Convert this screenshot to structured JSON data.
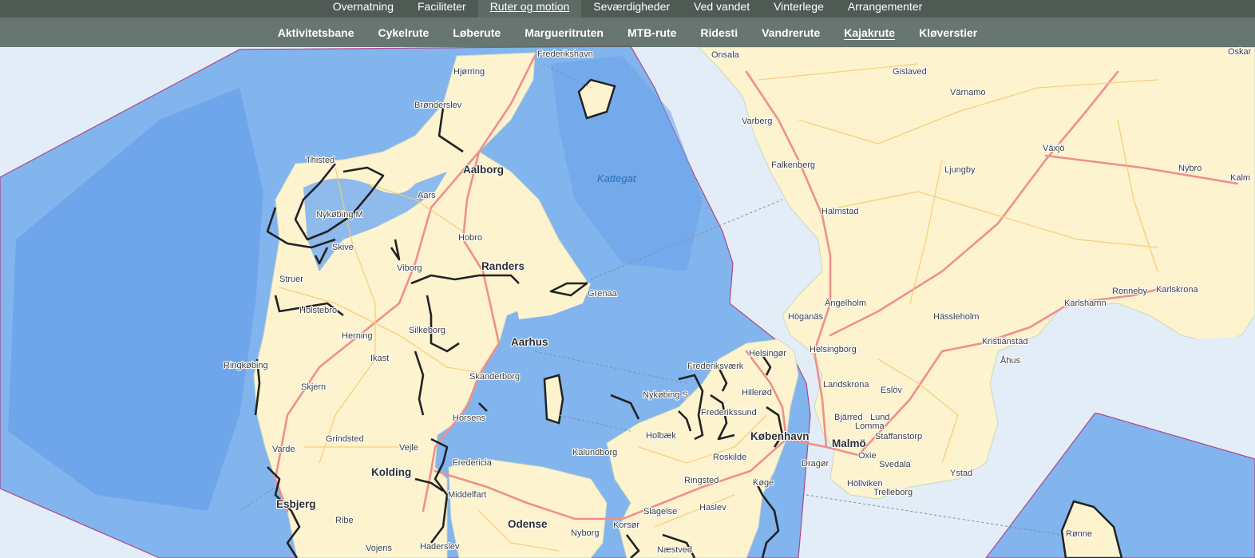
{
  "nav_primary": {
    "items": [
      "Overnatning",
      "Faciliteter",
      "Ruter og motion",
      "Seværdigheder",
      "Ved vandet",
      "Vinterlege",
      "Arrangementer"
    ],
    "active": "Ruter og motion"
  },
  "nav_secondary": {
    "items": [
      "Aktivitetsbane",
      "Cykelrute",
      "Løberute",
      "Margueritruten",
      "MTB-rute",
      "Ridesti",
      "Vandrerute",
      "Kajakrute",
      "Kløverstier"
    ],
    "active": "Kajakrute"
  },
  "map": {
    "sea_labels": [
      "Kattegat"
    ],
    "major_cities": [
      "Aalborg",
      "Randers",
      "Aarhus",
      "Kolding",
      "Esbjerg",
      "Odense",
      "København",
      "Malmö"
    ],
    "towns": [
      "Frederikshavn",
      "Hjørring",
      "Brønderslev",
      "Thisted",
      "Aars",
      "Nykøbing M",
      "Hobro",
      "Skive",
      "Viborg",
      "Struer",
      "Grenaa",
      "Holstebro",
      "Herning",
      "Silkeborg",
      "Ikast",
      "Ringkøbing",
      "Skanderborg",
      "Skjern",
      "Horsens",
      "Grindsted",
      "Vejle",
      "Varde",
      "Fredericia",
      "Middelfart",
      "Ribe",
      "Vojens",
      "Haderslev",
      "Nyborg",
      "Korsør",
      "Slagelse",
      "Næstved",
      "Haslev",
      "Ringsted",
      "Køge",
      "Roskilde",
      "Holbæk",
      "Kalundborg",
      "Nykøbing S",
      "Frederiksværk",
      "Hillerød",
      "Helsingør",
      "Frederikssund",
      "Dragør",
      "Ronne_dk",
      "Onsala",
      "Varberg",
      "Falkenberg",
      "Halmstad",
      "Gislaved",
      "Värnamo",
      "Ljungby",
      "Växjö",
      "Nybro",
      "Kalm",
      "Oskar",
      "Ängelholm",
      "Höganäs",
      "Helsingborg",
      "Hässleholm",
      "Kristianstad",
      "Åhus",
      "Landskrona",
      "Eslöv",
      "Bjärred",
      "Lund",
      "Lomma",
      "Staffanstorp",
      "Oxie",
      "Svedala",
      "Höllviken",
      "Trelleborg",
      "Ystad",
      "Karlshamn",
      "Ronneby",
      "Karlskrona"
    ],
    "town_display": {
      "Ronne_dk": "Rønne"
    },
    "colors": {
      "sea": "#e3edf8",
      "coastal_water": "#7fb2ee",
      "deep_water": "#5b95e6",
      "land": "#fdf3cf",
      "major_road": "#ef8f8c",
      "minor_road": "#f6cd73",
      "kayak_route": "#222222",
      "border": "#b0468a"
    }
  }
}
